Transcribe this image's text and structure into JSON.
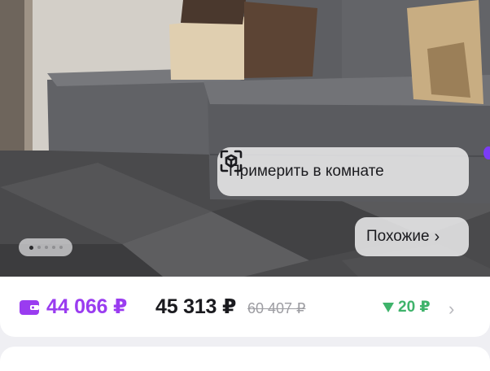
{
  "product_image": {
    "try_in_room_label": "Примерить в комнате",
    "similar_label": "Похожие",
    "similar_chevron": "›",
    "gallery_dots_count": 5,
    "gallery_active_index": 0
  },
  "pricing": {
    "card_price": "44 066 ₽",
    "price": "45 313 ₽",
    "old_price": "60 407 ₽",
    "cashback": "20 ₽",
    "chevron": "›"
  },
  "colors": {
    "card_price": "#9a3cf0",
    "cashback": "#3fb36b",
    "accent": "#7b3cf5"
  },
  "icons": {
    "wallet": "wallet-icon",
    "ar": "ar-cube-icon",
    "cashback_arrow": "triangle-down-icon"
  }
}
